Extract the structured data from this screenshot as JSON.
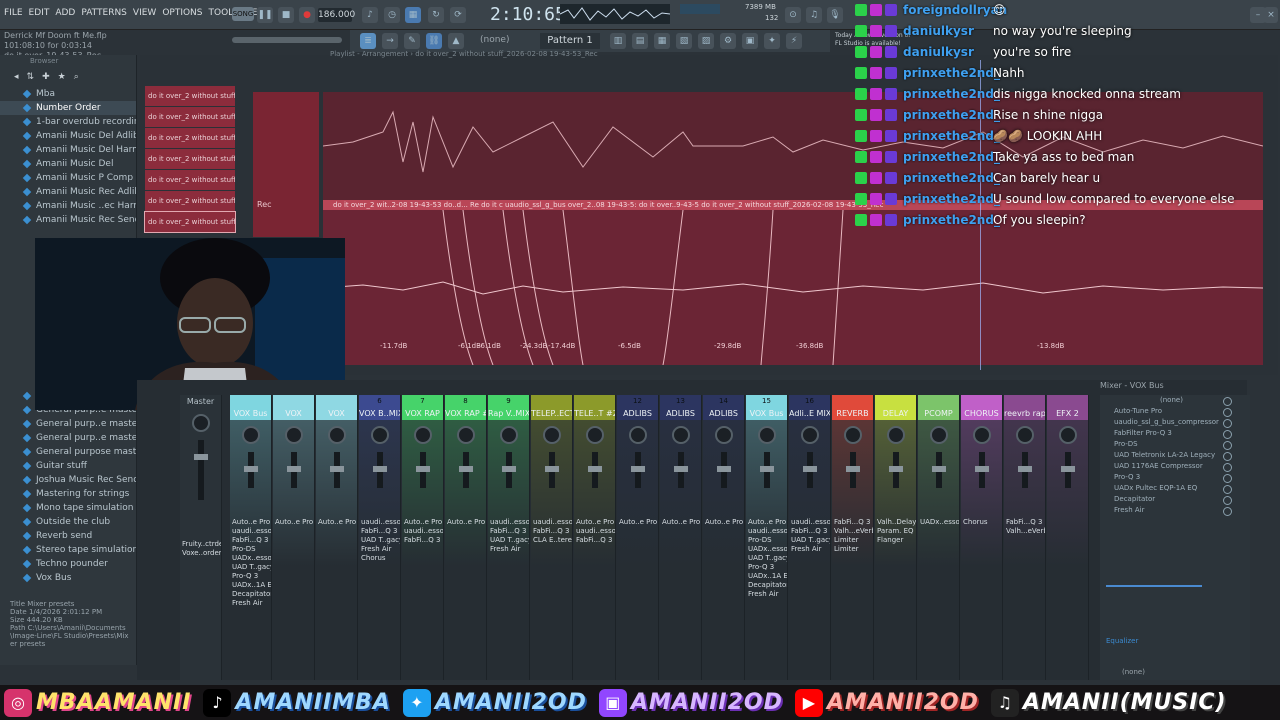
{
  "menu": [
    "FILE",
    "EDIT",
    "ADD",
    "PATTERNS",
    "VIEW",
    "OPTIONS",
    "TOOLS",
    "HELP"
  ],
  "hint": {
    "line1": "Derrick Mf Doom ft Me.flp",
    "line2": "101:08:10 for 0:03:14",
    "line3": "do it over_19-43-53_Rec"
  },
  "transport": {
    "song_label": "SONG",
    "tempo": "186.000",
    "song_time": "2:10:65",
    "cpu": "7389 MB",
    "voices": "132"
  },
  "notice": {
    "line1": "Today  A newer version of",
    "line2": "FL Studio is available!"
  },
  "playlist": {
    "pattern": "Pattern 1",
    "pattern_none": "(none)",
    "title": "Playlist - Arrangement › do it over_2 without stuff_2026-02-08 19-43-53_Rec",
    "rec_label": "Rec",
    "clips": [
      "do it over_2 without stuff",
      "do it over_2 without stuff",
      "do it over_2 without stuff",
      "do it over_2 without stuff",
      "do it over_2 without stuff",
      "do it over_2 without stuff",
      "do it over_2 without stuff"
    ],
    "clipbar_text": "do it over_2 wit..2-08 19-43-53  do..d... Re  do it c  uaudio_ssl_g_bus  over_2..08 19-43-5:  do it over..9-43-5  do it over_2 without stuff_2026-02-08 19-43-53_Rec",
    "db_labels": [
      "-11.7dB",
      "-6.1dB",
      "-6.1dB",
      "-24.3dB",
      "-17.4dB",
      "-6.5dB",
      "-29.8dB",
      "-36.8dB",
      "-13.8dB"
    ]
  },
  "browser": {
    "header": "Browser",
    "items": [
      "Mba",
      "Number Order",
      "1-bar overdub recording",
      "Amanii Music Del Adlibs",
      "Amanii Music Del Harmonies",
      "Amanii Music Del",
      "Amanii Music P Comp",
      "Amanii Music Rec Adlibs",
      "Amanii Music ..ec Harmonies",
      "Amanii Music Rec Send"
    ],
    "items_lower": [
      "General purpo..ir mastering",
      "General purp..e mastering 2",
      "General purp..e mastering 3",
      "General purp..e mastering 4",
      "General purpose mastering",
      "Guitar stuff",
      "Joshua Music Rec Send",
      "Mastering for strings",
      "Mono tape simulation",
      "Outside the club",
      "Reverb send",
      "Stereo tape simulation",
      "Techno pounder",
      "Vox Bus"
    ],
    "info": {
      "title_label": "Title",
      "title": "Mixer presets",
      "date_label": "Date",
      "date": "1/4/2026 2:01:12 PM",
      "size_label": "Size",
      "size": "444.20 KB",
      "path_label": "Path",
      "path": "C:\\Users\\Amanii\\Documents\\Image-Line\\FL Studio\\Presets\\Mixer presets"
    }
  },
  "chat": [
    {
      "user": "foreigndollryan",
      "text": "😊"
    },
    {
      "user": "daniulkysr",
      "text": "no way you're sleeping"
    },
    {
      "user": "daniulkysr",
      "text": "you're so fire"
    },
    {
      "user": "prinxethe2nd_",
      "text": "Nahh"
    },
    {
      "user": "prinxethe2nd_",
      "text": "dis nigga knocked onna stream"
    },
    {
      "user": "prinxethe2nd_",
      "text": "Rise n shine nigga"
    },
    {
      "user": "prinxethe2nd_",
      "text": "🥔🥔 LOOKIN AHH"
    },
    {
      "user": "prinxethe2nd_",
      "text": "Take ya ass to bed man"
    },
    {
      "user": "prinxethe2nd_",
      "text": "Can barely hear u"
    },
    {
      "user": "prinxethe2nd_",
      "text": "U sound low compared to everyone else"
    },
    {
      "user": "prinxethe2nd_",
      "text": "Of you sleepin?"
    }
  ],
  "mixer": {
    "title": "Mixer - VOX Bus",
    "master": "Master",
    "master_fx": [
      "Fruity..ctrde",
      "Voxe..order"
    ],
    "strips": [
      {
        "num": "",
        "name": "VOX Bus",
        "color": "#7fd6e0",
        "fx": [
          "Auto..e Pro",
          "uaudi..essor",
          "FabFi...Q 3",
          "Pro-DS",
          "UADx..essor",
          "UAD T..gacy",
          "Pro-Q 3",
          "UADx..1A EQ",
          "Decapitator",
          "Fresh Air"
        ]
      },
      {
        "num": "",
        "name": "VOX",
        "color": "#8fd8e3",
        "fx": [
          "Auto..e Pro"
        ]
      },
      {
        "num": "",
        "name": "VOX",
        "color": "#8fd8e3",
        "fx": [
          "Auto..e Pro"
        ]
      },
      {
        "num": "6",
        "name": "VOX B..MIX)",
        "color": "#3c4a90",
        "fx": [
          "uaudi..essor",
          "FabFi...Q 3",
          "UAD T..gacy",
          "Fresh Air",
          "Chorus"
        ]
      },
      {
        "num": "7",
        "name": "VOX RAP",
        "color": "#46d36a",
        "fx": [
          "Auto..e Pro",
          "uaudi..essor",
          "FabFi...Q 3"
        ]
      },
      {
        "num": "8",
        "name": "VOX RAP #2",
        "color": "#46d36a",
        "fx": [
          "Auto..e Pro"
        ]
      },
      {
        "num": "9",
        "name": "Rap V..MIX)",
        "color": "#46d36a",
        "fx": [
          "uaudi..essor",
          "FabFi...Q 3",
          "UAD T..gacy",
          "Fresh Air"
        ]
      },
      {
        "num": "",
        "name": "TELEP..ECT",
        "color": "#8c9a2a",
        "fx": [
          "uaudi..essor",
          "FabFi...Q 3",
          "CLA E..tereo"
        ]
      },
      {
        "num": "",
        "name": "TELE..T #2",
        "color": "#8c9a2a",
        "fx": [
          "Auto..e Pro",
          "uaudi..essor",
          "FabFi...Q 3"
        ]
      },
      {
        "num": "12",
        "name": "ADLIBS",
        "color": "#2c3560",
        "fx": [
          "Auto..e Pro"
        ]
      },
      {
        "num": "13",
        "name": "ADLIBS",
        "color": "#2c3560",
        "fx": [
          "Auto..e Pro"
        ]
      },
      {
        "num": "14",
        "name": "ADLIBS",
        "color": "#2c3560",
        "fx": [
          "Auto..e Pro"
        ]
      },
      {
        "num": "15",
        "name": "VOX Bus",
        "color": "#7fd6e0",
        "fx": [
          "Auto..e Pro",
          "uaudi..essor",
          "Pro-DS",
          "UADx..essor",
          "UAD T..gacy",
          "Pro-Q 3",
          "UADx..1A EQ",
          "Decapitator",
          "Fresh Air"
        ]
      },
      {
        "num": "16",
        "name": "Adli..E MIX",
        "color": "#2c3560",
        "fx": [
          "uaudi..essor",
          "FabFi...Q 3",
          "UAD T..gacy",
          "Fresh Air"
        ]
      },
      {
        "num": "",
        "name": "REVERB",
        "color": "#e04a3a",
        "fx": [
          "FabFi...Q 3",
          "Valh...eVerb",
          "Limiter",
          "Limiter"
        ]
      },
      {
        "num": "",
        "name": "DELAY",
        "color": "#c8e040",
        "fx": [
          "Valh..Delay",
          "Param. EQ 2",
          "Flanger"
        ]
      },
      {
        "num": "",
        "name": "PCOMP",
        "color": "#7cc46a",
        "fx": [
          "UADx..essor"
        ]
      },
      {
        "num": "",
        "name": "CHORUS",
        "color": "#c060c8",
        "fx": [
          "Chorus"
        ]
      },
      {
        "num": "",
        "name": "reevrb rap",
        "color": "#8a4a90",
        "fx": [
          "FabFi...Q 3",
          "Valh...eVerb"
        ]
      },
      {
        "num": "",
        "name": "EFX 2",
        "color": "#8a4a90",
        "fx": []
      }
    ],
    "slots": [
      "(none)",
      "Auto-Tune Pro",
      "uaudio_ssl_g_bus_compressor",
      "FabFilter Pro-Q 3",
      "Pro-DS",
      "UAD Teletronix LA-2A Legacy",
      "UAD 1176AE Compressor",
      "Pro-Q 3",
      "UADx Pultec EQP-1A EQ",
      "Decapitator",
      "Fresh Air"
    ],
    "slot_none": "(none)",
    "equalizer": "Equalizer"
  },
  "social": [
    {
      "icon": "instagram-icon",
      "color": "#d6336c",
      "handle": "MBAAMANII",
      "style": ""
    },
    {
      "icon": "tiktok-icon",
      "color": "#000000",
      "handle": "AMANIIMBA",
      "style": "b"
    },
    {
      "icon": "twitter-icon",
      "color": "#1da1f2",
      "handle": "AMANII2OD",
      "style": "b"
    },
    {
      "icon": "twitch-icon",
      "color": "#9146ff",
      "handle": "AMANII2OD",
      "style": "p"
    },
    {
      "icon": "youtube-icon",
      "color": "#ff0000",
      "handle": "AMANII2OD",
      "style": "r"
    },
    {
      "icon": "music-icon",
      "color": "#222222",
      "handle": "AMANII(MUSIC)",
      "style": "w"
    }
  ]
}
